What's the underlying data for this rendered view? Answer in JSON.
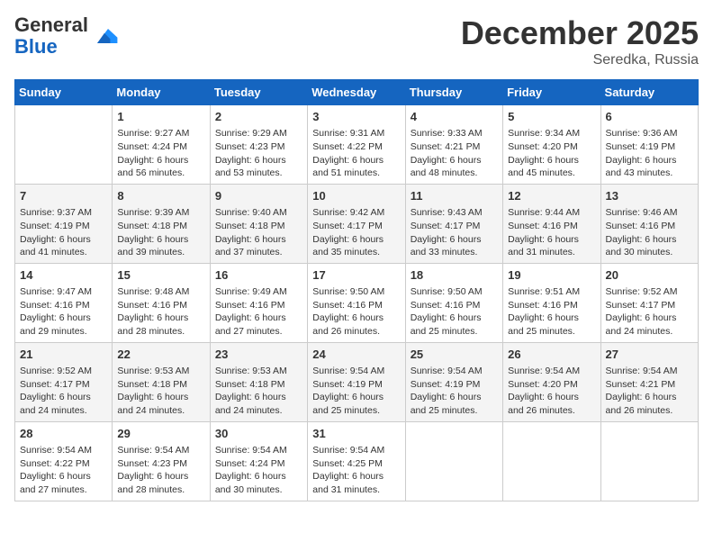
{
  "logo": {
    "general": "General",
    "blue": "Blue"
  },
  "header": {
    "month": "December 2025",
    "location": "Seredka, Russia"
  },
  "weekdays": [
    "Sunday",
    "Monday",
    "Tuesday",
    "Wednesday",
    "Thursday",
    "Friday",
    "Saturday"
  ],
  "weeks": [
    [
      {
        "day": "",
        "info": ""
      },
      {
        "day": "1",
        "info": "Sunrise: 9:27 AM\nSunset: 4:24 PM\nDaylight: 6 hours and 56 minutes."
      },
      {
        "day": "2",
        "info": "Sunrise: 9:29 AM\nSunset: 4:23 PM\nDaylight: 6 hours and 53 minutes."
      },
      {
        "day": "3",
        "info": "Sunrise: 9:31 AM\nSunset: 4:22 PM\nDaylight: 6 hours and 51 minutes."
      },
      {
        "day": "4",
        "info": "Sunrise: 9:33 AM\nSunset: 4:21 PM\nDaylight: 6 hours and 48 minutes."
      },
      {
        "day": "5",
        "info": "Sunrise: 9:34 AM\nSunset: 4:20 PM\nDaylight: 6 hours and 45 minutes."
      },
      {
        "day": "6",
        "info": "Sunrise: 9:36 AM\nSunset: 4:19 PM\nDaylight: 6 hours and 43 minutes."
      }
    ],
    [
      {
        "day": "7",
        "info": "Sunrise: 9:37 AM\nSunset: 4:19 PM\nDaylight: 6 hours and 41 minutes."
      },
      {
        "day": "8",
        "info": "Sunrise: 9:39 AM\nSunset: 4:18 PM\nDaylight: 6 hours and 39 minutes."
      },
      {
        "day": "9",
        "info": "Sunrise: 9:40 AM\nSunset: 4:18 PM\nDaylight: 6 hours and 37 minutes."
      },
      {
        "day": "10",
        "info": "Sunrise: 9:42 AM\nSunset: 4:17 PM\nDaylight: 6 hours and 35 minutes."
      },
      {
        "day": "11",
        "info": "Sunrise: 9:43 AM\nSunset: 4:17 PM\nDaylight: 6 hours and 33 minutes."
      },
      {
        "day": "12",
        "info": "Sunrise: 9:44 AM\nSunset: 4:16 PM\nDaylight: 6 hours and 31 minutes."
      },
      {
        "day": "13",
        "info": "Sunrise: 9:46 AM\nSunset: 4:16 PM\nDaylight: 6 hours and 30 minutes."
      }
    ],
    [
      {
        "day": "14",
        "info": "Sunrise: 9:47 AM\nSunset: 4:16 PM\nDaylight: 6 hours and 29 minutes."
      },
      {
        "day": "15",
        "info": "Sunrise: 9:48 AM\nSunset: 4:16 PM\nDaylight: 6 hours and 28 minutes."
      },
      {
        "day": "16",
        "info": "Sunrise: 9:49 AM\nSunset: 4:16 PM\nDaylight: 6 hours and 27 minutes."
      },
      {
        "day": "17",
        "info": "Sunrise: 9:50 AM\nSunset: 4:16 PM\nDaylight: 6 hours and 26 minutes."
      },
      {
        "day": "18",
        "info": "Sunrise: 9:50 AM\nSunset: 4:16 PM\nDaylight: 6 hours and 25 minutes."
      },
      {
        "day": "19",
        "info": "Sunrise: 9:51 AM\nSunset: 4:16 PM\nDaylight: 6 hours and 25 minutes."
      },
      {
        "day": "20",
        "info": "Sunrise: 9:52 AM\nSunset: 4:17 PM\nDaylight: 6 hours and 24 minutes."
      }
    ],
    [
      {
        "day": "21",
        "info": "Sunrise: 9:52 AM\nSunset: 4:17 PM\nDaylight: 6 hours and 24 minutes."
      },
      {
        "day": "22",
        "info": "Sunrise: 9:53 AM\nSunset: 4:18 PM\nDaylight: 6 hours and 24 minutes."
      },
      {
        "day": "23",
        "info": "Sunrise: 9:53 AM\nSunset: 4:18 PM\nDaylight: 6 hours and 24 minutes."
      },
      {
        "day": "24",
        "info": "Sunrise: 9:54 AM\nSunset: 4:19 PM\nDaylight: 6 hours and 25 minutes."
      },
      {
        "day": "25",
        "info": "Sunrise: 9:54 AM\nSunset: 4:19 PM\nDaylight: 6 hours and 25 minutes."
      },
      {
        "day": "26",
        "info": "Sunrise: 9:54 AM\nSunset: 4:20 PM\nDaylight: 6 hours and 26 minutes."
      },
      {
        "day": "27",
        "info": "Sunrise: 9:54 AM\nSunset: 4:21 PM\nDaylight: 6 hours and 26 minutes."
      }
    ],
    [
      {
        "day": "28",
        "info": "Sunrise: 9:54 AM\nSunset: 4:22 PM\nDaylight: 6 hours and 27 minutes."
      },
      {
        "day": "29",
        "info": "Sunrise: 9:54 AM\nSunset: 4:23 PM\nDaylight: 6 hours and 28 minutes."
      },
      {
        "day": "30",
        "info": "Sunrise: 9:54 AM\nSunset: 4:24 PM\nDaylight: 6 hours and 30 minutes."
      },
      {
        "day": "31",
        "info": "Sunrise: 9:54 AM\nSunset: 4:25 PM\nDaylight: 6 hours and 31 minutes."
      },
      {
        "day": "",
        "info": ""
      },
      {
        "day": "",
        "info": ""
      },
      {
        "day": "",
        "info": ""
      }
    ]
  ]
}
